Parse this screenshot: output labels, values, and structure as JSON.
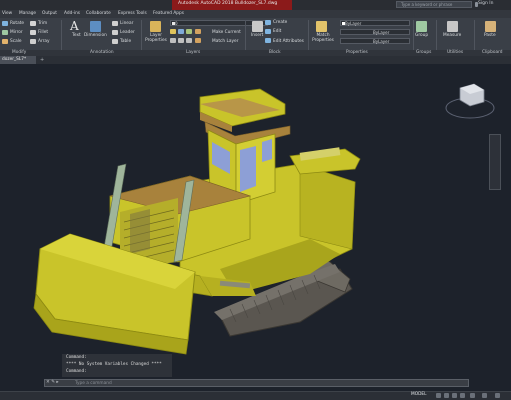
{
  "window": {
    "title": "Autodesk AutoCAD 2018   Bulldozer_SL7.dwg",
    "search_placeholder": "Type a keyword or phrase",
    "sign_in": "Sign In"
  },
  "menu": [
    "View",
    "Manage",
    "Output",
    "Add-ins",
    "Collaborate",
    "Express Tools",
    "Featured Apps"
  ],
  "ribbon": {
    "modify": {
      "move": "Move",
      "rotate": "Rotate",
      "trim": "Trim",
      "copy": "Copy",
      "mirror": "Mirror",
      "fillet": "Fillet",
      "stretch": "Stretch",
      "scale": "Scale",
      "array": "Array"
    },
    "annotation": {
      "text": "Text",
      "dimension": "Dimension",
      "linear": "Linear",
      "leader": "Leader",
      "table": "Table"
    },
    "layers": {
      "layer_properties": "Layer Properties",
      "current_layer": "0",
      "make_current": "Make Current",
      "match_layer": "Match Layer"
    },
    "block": {
      "insert": "Insert",
      "create": "Create",
      "edit": "Edit",
      "edit_attributes": "Edit Attributes"
    },
    "properties": {
      "match_properties": "Match Properties",
      "color": "ByLayer",
      "linetype": "ByLayer",
      "lineweight": "ByLayer"
    },
    "groups": {
      "group": "Group"
    },
    "utilities": {
      "measure": "Measure"
    },
    "clipboard": {
      "paste": "Paste"
    },
    "panel_titles": [
      "Modify",
      "Annotation",
      "Layers",
      "Block",
      "Properties",
      "Groups",
      "Utilities",
      "Clipboard"
    ]
  },
  "tabs": {
    "file_tab": "dozer_SL7*"
  },
  "command": {
    "history": [
      "Command:",
      "**** No System Variables Changed ****",
      "Command:"
    ],
    "placeholder": "Type a command"
  },
  "status": {
    "space": "MODEL"
  },
  "colors": {
    "background": "#1d222b",
    "model_yellow": "#c9c42a",
    "model_tan": "#a8823c",
    "track_gray": "#6e6a62",
    "glass_blue": "#8d9fd6",
    "accent_red": "#8b1a1a"
  }
}
